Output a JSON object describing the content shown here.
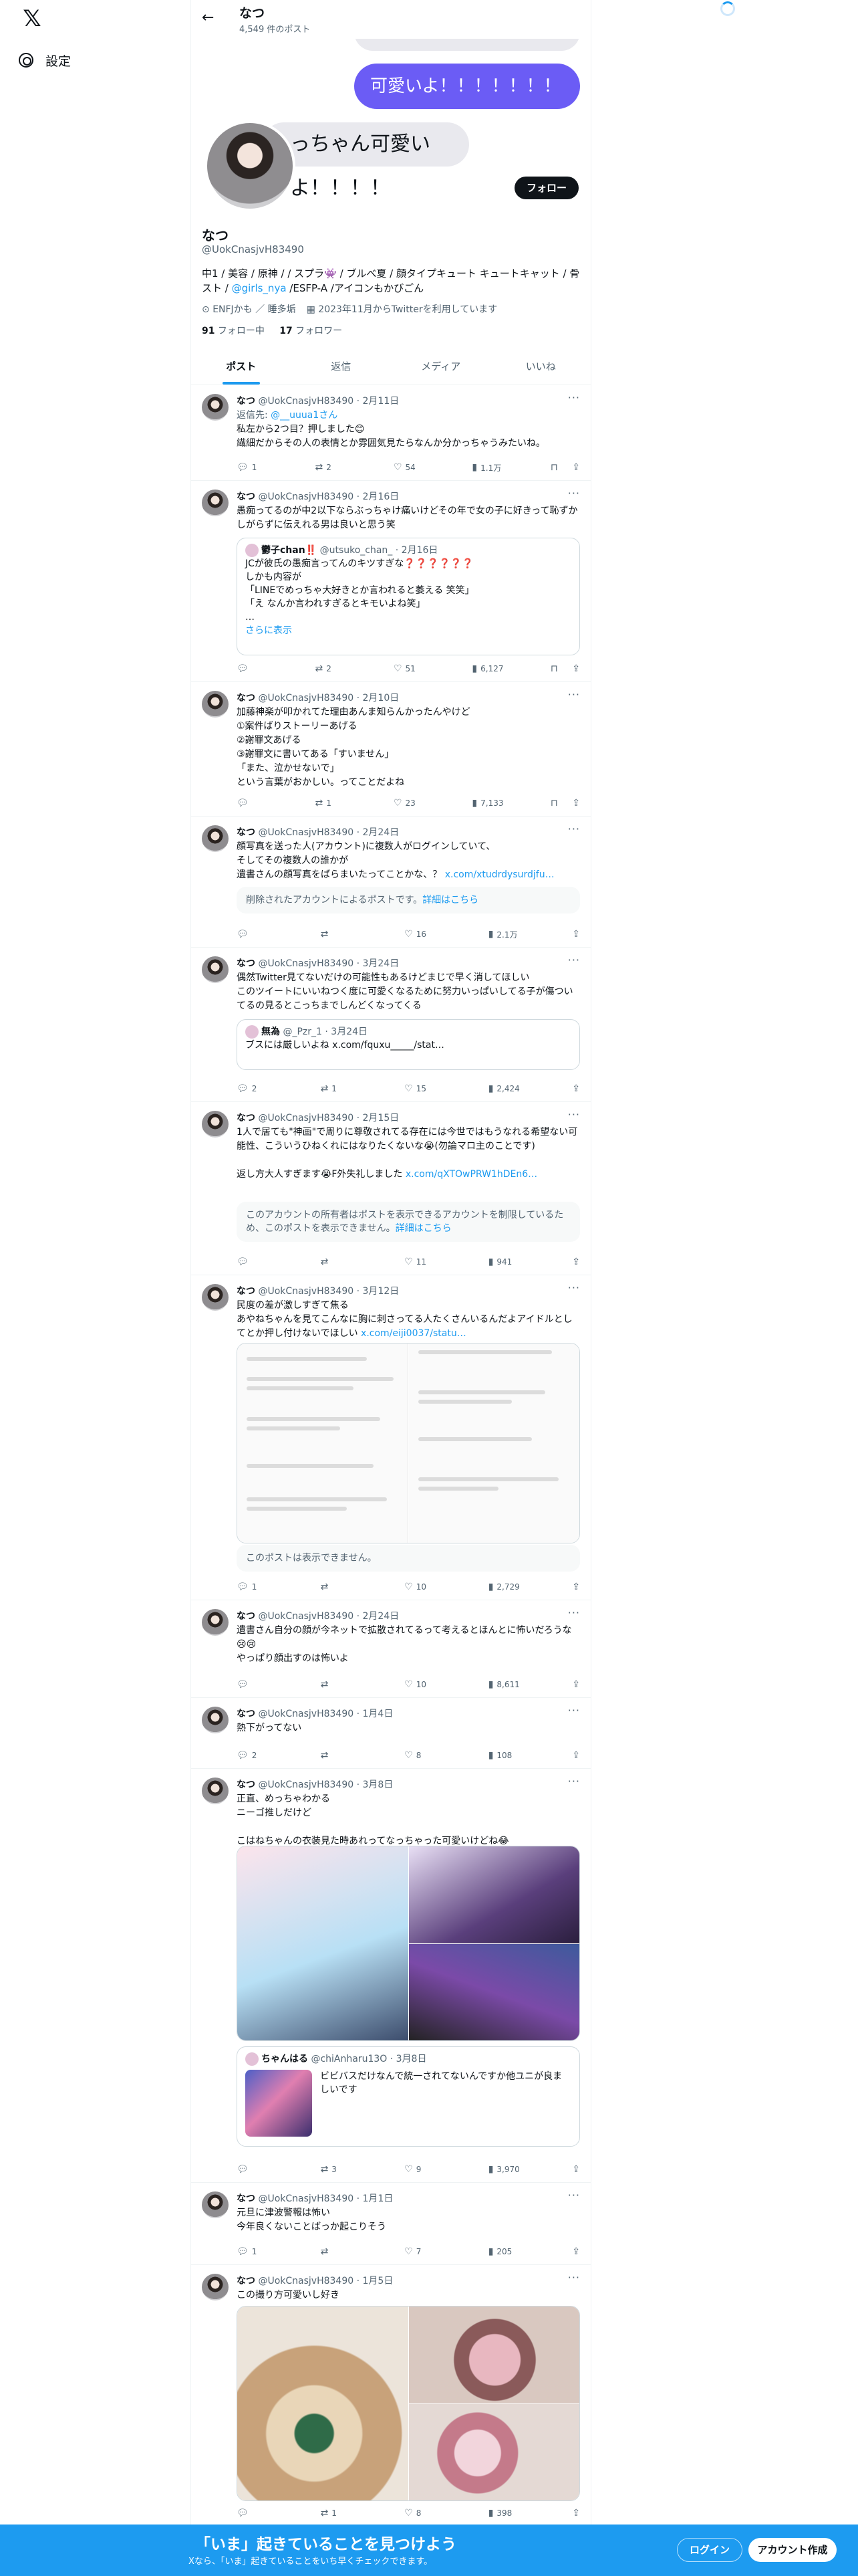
{
  "nav": {
    "settings": "設定"
  },
  "topbar": {
    "name": "なつ",
    "post_count": "4,549 件のポスト"
  },
  "banner": {
    "blue_bubble": "可愛いよ！！！！！！！",
    "gray_bubble": "っちゃん可愛いよ！！！！"
  },
  "profile": {
    "name": "なつ",
    "handle": "@UokCnasjvH83490",
    "follow_button": "フォロー",
    "bio_1": "中1 / 美容 / 原神 / / スプラ👾 / ブルべ夏 / 顔タイプキュート キュートキャット / 骨スト / ",
    "bio_link": "@girls_nya",
    "bio_2": " /ESFP-A /アイコンもかびごん",
    "location": "ENFJかも ／ 睡多垢",
    "joined": "2023年11月からTwitterを利用しています",
    "following_count": "91",
    "following_label": " フォロー中",
    "followers_count": "17",
    "followers_label": " フォロワー"
  },
  "tabs": [
    {
      "label": "ポスト"
    },
    {
      "label": "返信"
    },
    {
      "label": "メディア"
    },
    {
      "label": "いいね"
    }
  ],
  "posts": [
    {
      "name": "なつ",
      "handle": "@UokCnasjvH83490",
      "date": "2月11日",
      "reply_to_label": "返信先: ",
      "reply_to": "@__uuua1さん",
      "text": "私左から2つ目？押しました😊\n繊細だからその人の表情とか雰囲気見たらなんか分かっちゃうみたいね。",
      "replies": "1",
      "retweets": "2",
      "likes": "54",
      "views": "1.1万"
    },
    {
      "name": "なつ",
      "handle": "@UokCnasjvH83490",
      "date": "2月16日",
      "text": "愚痴ってるのが中2以下ならぶっちゃけ痛いけどその年で女の子に好きって恥ずかしがらずに伝えれる男は良いと思う笑",
      "quote": {
        "name": "鬱子chan‼️",
        "handle": "@utsuko_chan_",
        "date": "2月16日",
        "text": "JCが彼氏の愚痴言ってんのキツすぎな❓❓❓❓❓❓\nしかも内容が\n「LINEでめっちゃ大好きとか言われると萎える 笑笑」\n「え なんか言われすぎるとキモいよね笑」\n…",
        "more": "さらに表示"
      },
      "replies": "",
      "retweets": "2",
      "likes": "51",
      "views": "6,127"
    },
    {
      "name": "なつ",
      "handle": "@UokCnasjvH83490",
      "date": "2月10日",
      "text": "加藤神楽が叩かれてた理由あんま知らんかったんやけど\n①案件ばりストーリーあげる\n②謝罪文あげる\n③謝罪文に書いてある「すいません」\n「また、泣かせないで」\nという言葉がおかしい。ってことだよね",
      "replies": "",
      "retweets": "1",
      "likes": "23",
      "views": "7,133"
    },
    {
      "name": "なつ",
      "handle": "@UokCnasjvH83490",
      "date": "2月24日",
      "text": "顔写真を送った人(アカウント)に複数人がログインしていて、\nそしてその複数人の誰かが\n遺書さんの顔写真をばらまいたってことかな、？ ",
      "text_link": "x.com/xtudrdysurdjfu…",
      "notice": "削除されたアカウントによるポストです。",
      "notice_link": "詳細はこちら",
      "replies": "",
      "retweets": "",
      "likes": "16",
      "views": "2.1万"
    },
    {
      "name": "なつ",
      "handle": "@UokCnasjvH83490",
      "date": "3月24日",
      "text": "偶然Twitter見てないだけの可能性もあるけどまじで早く消してほしい\nこのツイートにいいねつく度に可愛くなるために努力いっぱいしてる子が傷ついてるの見るとこっちまでしんどくなってくる",
      "quote": {
        "name": "無為",
        "handle": "@_Pzr_1",
        "date": "3月24日",
        "text": "ブスには厳しいよね x.com/fquxu_____/stat…"
      },
      "replies": "2",
      "retweets": "1",
      "likes": "15",
      "views": "2,424"
    },
    {
      "name": "なつ",
      "handle": "@UokCnasjvH83490",
      "date": "2月15日",
      "text": "1人で居ても\"神画\"で周りに尊敬されてる存在には今世ではもうなれる希望ない可能性、こういうひねくれにはなりたくないな😭(勿論マロ主のことです)\n\n返し方大人すぎます😭F外失礼しました ",
      "text_link": "x.com/qXTOwPRW1hDEn6…",
      "notice": "このアカウントの所有者はポストを表示できるアカウントを制限しているため、このポストを表示できません。",
      "notice_link": "詳細はこちら",
      "replies": "",
      "retweets": "",
      "likes": "11",
      "views": "941"
    },
    {
      "name": "なつ",
      "handle": "@UokCnasjvH83490",
      "date": "3月12日",
      "text": "民度の差が激しすぎて焦る\nあやねちゃんを見てこんなに胸に刺さってる人たくさんいるんだよアイドルとしてとか押し付けないでほしい ",
      "text_link": "x.com/eiji0037/statu…",
      "notice": "このポストは表示できません。",
      "replies": "1",
      "retweets": "",
      "likes": "10",
      "views": "2,729"
    },
    {
      "name": "なつ",
      "handle": "@UokCnasjvH83490",
      "date": "2月24日",
      "text": "遺書さん自分の顔が今ネットで拡散されてるって考えるとほんとに怖いだろうな😢😢\nやっぱり顔出すのは怖いよ",
      "replies": "",
      "retweets": "",
      "likes": "10",
      "views": "8,611"
    },
    {
      "name": "なつ",
      "handle": "@UokCnasjvH83490",
      "date": "1月4日",
      "text": "熱下がってない",
      "replies": "2",
      "retweets": "",
      "likes": "8",
      "views": "108"
    },
    {
      "name": "なつ",
      "handle": "@UokCnasjvH83490",
      "date": "3月8日",
      "text": "正直、めっちゃわかる\nニーゴ推しだけど\n\nこはねちゃんの衣装見た時あれってなっちゃった可愛いけどね😂",
      "quote": {
        "name": "ちゃんはる",
        "handle": "@chiAnharu13O",
        "date": "3月8日",
        "text": "ビビバスだけなんで統一されてないんですか他ユニが良ましいです"
      },
      "replies": "",
      "retweets": "3",
      "likes": "9",
      "views": "3,970"
    },
    {
      "name": "なつ",
      "handle": "@UokCnasjvH83490",
      "date": "1月1日",
      "text": "元旦に津波警報は怖い\n今年良くないことばっか起こりそう",
      "replies": "1",
      "retweets": "",
      "likes": "7",
      "views": "205"
    },
    {
      "name": "なつ",
      "handle": "@UokCnasjvH83490",
      "date": "1月5日",
      "text": "この撮り方可愛いし好き",
      "replies": "",
      "retweets": "1",
      "likes": "8",
      "views": "398"
    }
  ],
  "bottom_bar": {
    "title": "「いま」起きていることを見つけよう",
    "subtitle": "Xなら、「いま」起きていることをいち早くチェックできます。",
    "login": "ログイン",
    "signup": "アカウント作成"
  },
  "colors": {
    "accent": "#1d9bf0",
    "bubble_blue": "#6b5cf5"
  }
}
